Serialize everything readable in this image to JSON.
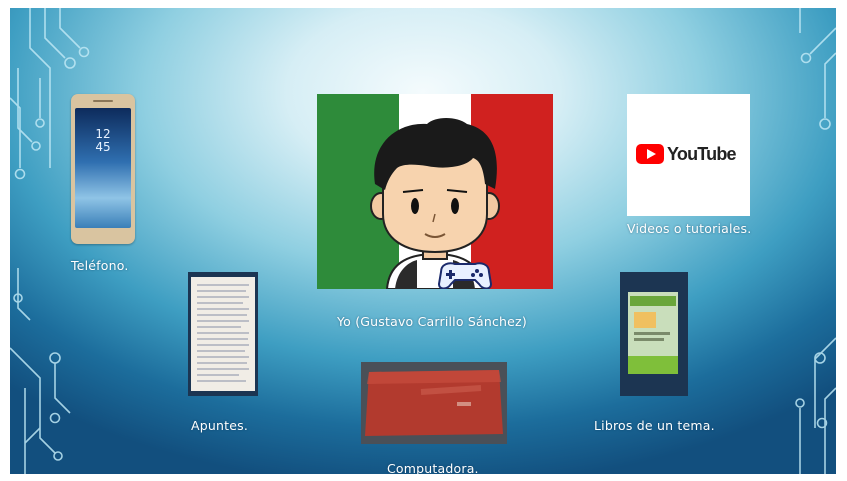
{
  "slide": {
    "items": [
      {
        "id": "phone",
        "caption": "Teléfono.",
        "icon": "smartphone-photo"
      },
      {
        "id": "avatar",
        "caption": "Yo (Gustavo Carrillo Sánchez)",
        "icon": "cartoon-avatar-mexico-flag"
      },
      {
        "id": "youtube",
        "caption": "Videos o tutoriales.",
        "icon": "youtube-logo"
      },
      {
        "id": "notes",
        "caption": "Apuntes.",
        "icon": "handwritten-notes-photo"
      },
      {
        "id": "laptop",
        "caption": "Computadora.",
        "icon": "laptop-photo"
      },
      {
        "id": "book",
        "caption": "Libros de un tema.",
        "icon": "book-photo"
      }
    ],
    "phone_clock": [
      "12",
      "45"
    ],
    "youtube_logo_text": "YouTube",
    "colors": {
      "flag_green": "#2e8b3a",
      "flag_white": "#ffffff",
      "flag_red": "#d0211f",
      "youtube_red": "#ff0000",
      "circuit_line": "#b9e6f4"
    }
  }
}
